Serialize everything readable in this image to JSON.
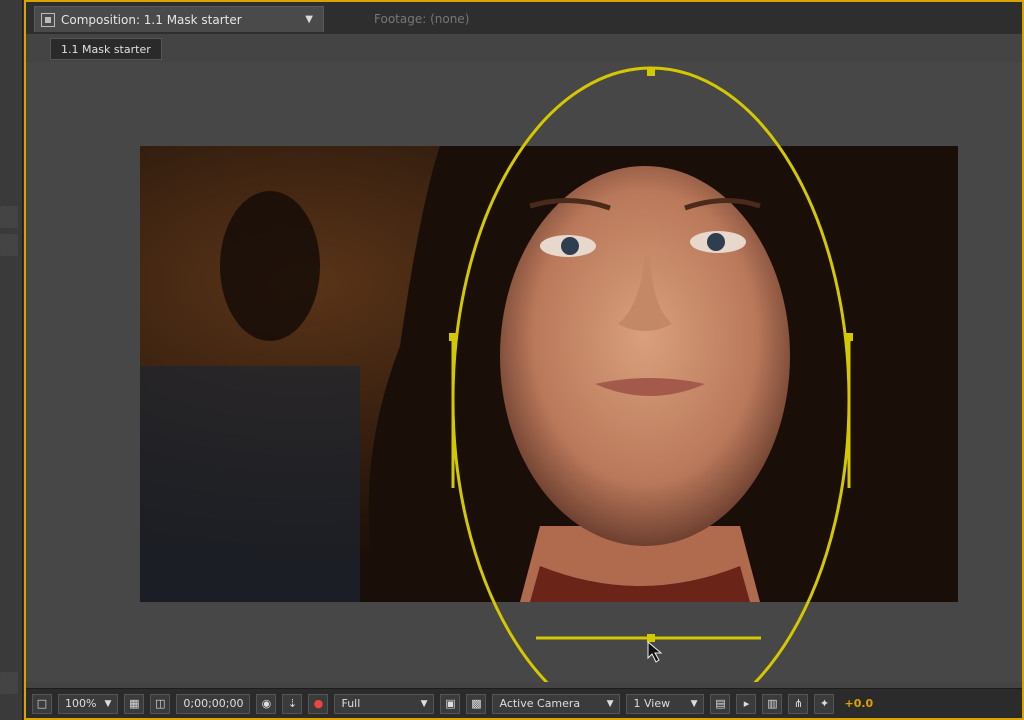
{
  "tabs": {
    "composition_label": "Composition: 1.1 Mask starter",
    "footage_label": "Footage: (none)"
  },
  "breadcrumb": "1.1 Mask starter",
  "viewer_controls": {
    "magnification": "100%",
    "timecode": "0;00;00;00",
    "resolution": "Full",
    "view": "Active Camera",
    "views_count": "1 View",
    "exposure": "+0.0"
  },
  "colors": {
    "panel_highlight": "#d9a400",
    "mask_path": "#d4c800"
  },
  "icons": {
    "composition": "composition-icon",
    "snapshot": "camera-icon",
    "channel": "rgb-channel-icon",
    "grid": "grid-icon",
    "mask_visibility": "mask-icon"
  }
}
